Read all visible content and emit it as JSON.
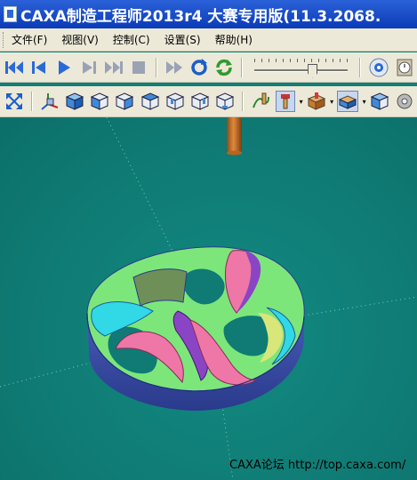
{
  "window": {
    "title": "CAXA制造工程师2013r4 大赛专用版(11.3.2068.",
    "app_icon": "caxa-app-icon"
  },
  "menu": {
    "items": [
      {
        "label": "文件(F)",
        "name": "menu-file"
      },
      {
        "label": "视图(V)",
        "name": "menu-view"
      },
      {
        "label": "控制(C)",
        "name": "menu-control"
      },
      {
        "label": "设置(S)",
        "name": "menu-settings"
      },
      {
        "label": "帮助(H)",
        "name": "menu-help"
      }
    ]
  },
  "toolbar_playback": {
    "buttons": [
      "skip-to-start-icon",
      "step-back-icon",
      "play-icon",
      "step-forward-icon",
      "skip-to-end-icon",
      "stop-icon",
      "fast-forward-icon",
      "rotate-view-icon",
      "refresh-icon"
    ],
    "speed_slider_value": 0.62,
    "trailing_icons": [
      "inspect-icon",
      "clock-icon"
    ]
  },
  "toolbar_view": {
    "buttons": [
      "fit-view-icon",
      "axis-icon",
      "iso-view-icon",
      "front-view-icon",
      "right-view-icon",
      "top-view-icon",
      "back-view-icon",
      "left-view-icon",
      "bottom-view-icon",
      "tool-path-icon",
      "tool-display-icon",
      "stock-icon",
      "workpiece-icon",
      "shaded-cube-icon",
      "gear-icon"
    ]
  },
  "viewport": {
    "background_color": "#0f7f78",
    "watermark": "CAXA论坛 http://top.caxa.com/"
  },
  "colors": {
    "titlebar": "#0a3bb8",
    "chrome": "#ece9d8",
    "part_base": "#3c55b8",
    "part_top": "#7de67a",
    "cyan": "#31d8e6",
    "pink": "#ee77a7",
    "purple": "#8a45c5",
    "tool": "#c9722a"
  }
}
